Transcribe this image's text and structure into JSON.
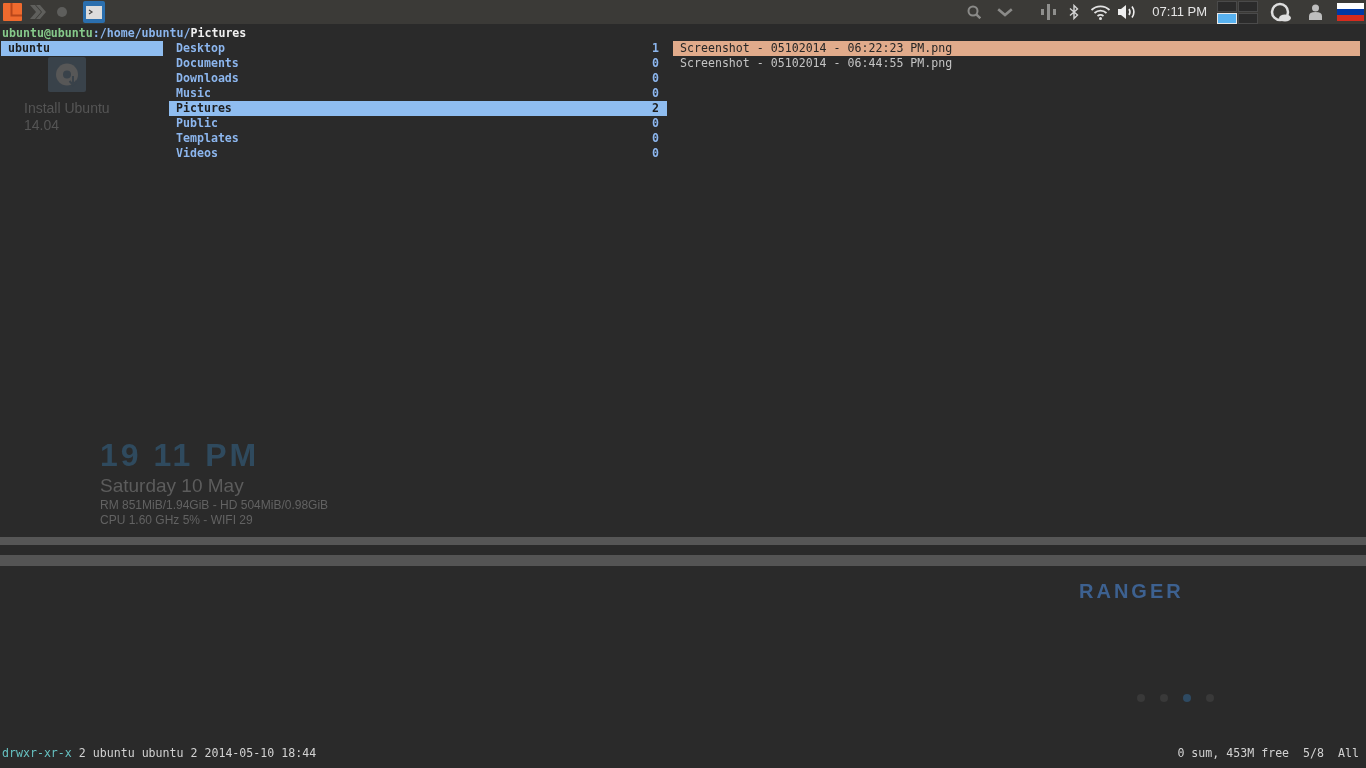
{
  "top_panel": {
    "clock": "07:11 PM",
    "workspaces": [
      {
        "selected": false
      },
      {
        "selected": false
      },
      {
        "selected": true
      },
      {
        "selected": false
      }
    ]
  },
  "desktop": {
    "icon_label": "Install Ubuntu 14.04",
    "conky": {
      "time": "19 11 PM",
      "date": "Saturday 10 May",
      "memory": "RM 851MiB/1.94GiB - HD 504MiB/0.98GiB",
      "cpu": "CPU 1.60 GHz 5% - WIFI 29"
    },
    "logo": "RANGER",
    "page_dots": [
      {
        "selected": false
      },
      {
        "selected": false
      },
      {
        "selected": true
      },
      {
        "selected": false
      }
    ]
  },
  "ranger": {
    "title": {
      "host": "ubuntu@ubuntu",
      "directory": ":/home/ubuntu/",
      "current": "Pictures"
    },
    "parent_column": [
      {
        "name": "ubuntu",
        "selected": true
      }
    ],
    "current_column": [
      {
        "name": "Desktop",
        "count": "1",
        "selected": false
      },
      {
        "name": "Documents",
        "count": "0",
        "selected": false
      },
      {
        "name": "Downloads",
        "count": "0",
        "selected": false
      },
      {
        "name": "Music",
        "count": "0",
        "selected": false
      },
      {
        "name": "Pictures",
        "count": "2",
        "selected": true
      },
      {
        "name": "Public",
        "count": "0",
        "selected": false
      },
      {
        "name": "Templates",
        "count": "0",
        "selected": false
      },
      {
        "name": "Videos",
        "count": "0",
        "selected": false
      }
    ],
    "preview_column": [
      {
        "name": "Screenshot - 05102014 - 06:22:23 PM.png",
        "selected": true
      },
      {
        "name": "Screenshot - 05102014 - 06:44:55 PM.png",
        "selected": false
      }
    ],
    "status_bar": {
      "permissions": "drwxr-xr-x",
      "info": "2 ubuntu ubuntu 2 2014-05-10 18:44",
      "summary": "0 sum, 453M free",
      "position": "5/8",
      "scroll": "All"
    }
  }
}
